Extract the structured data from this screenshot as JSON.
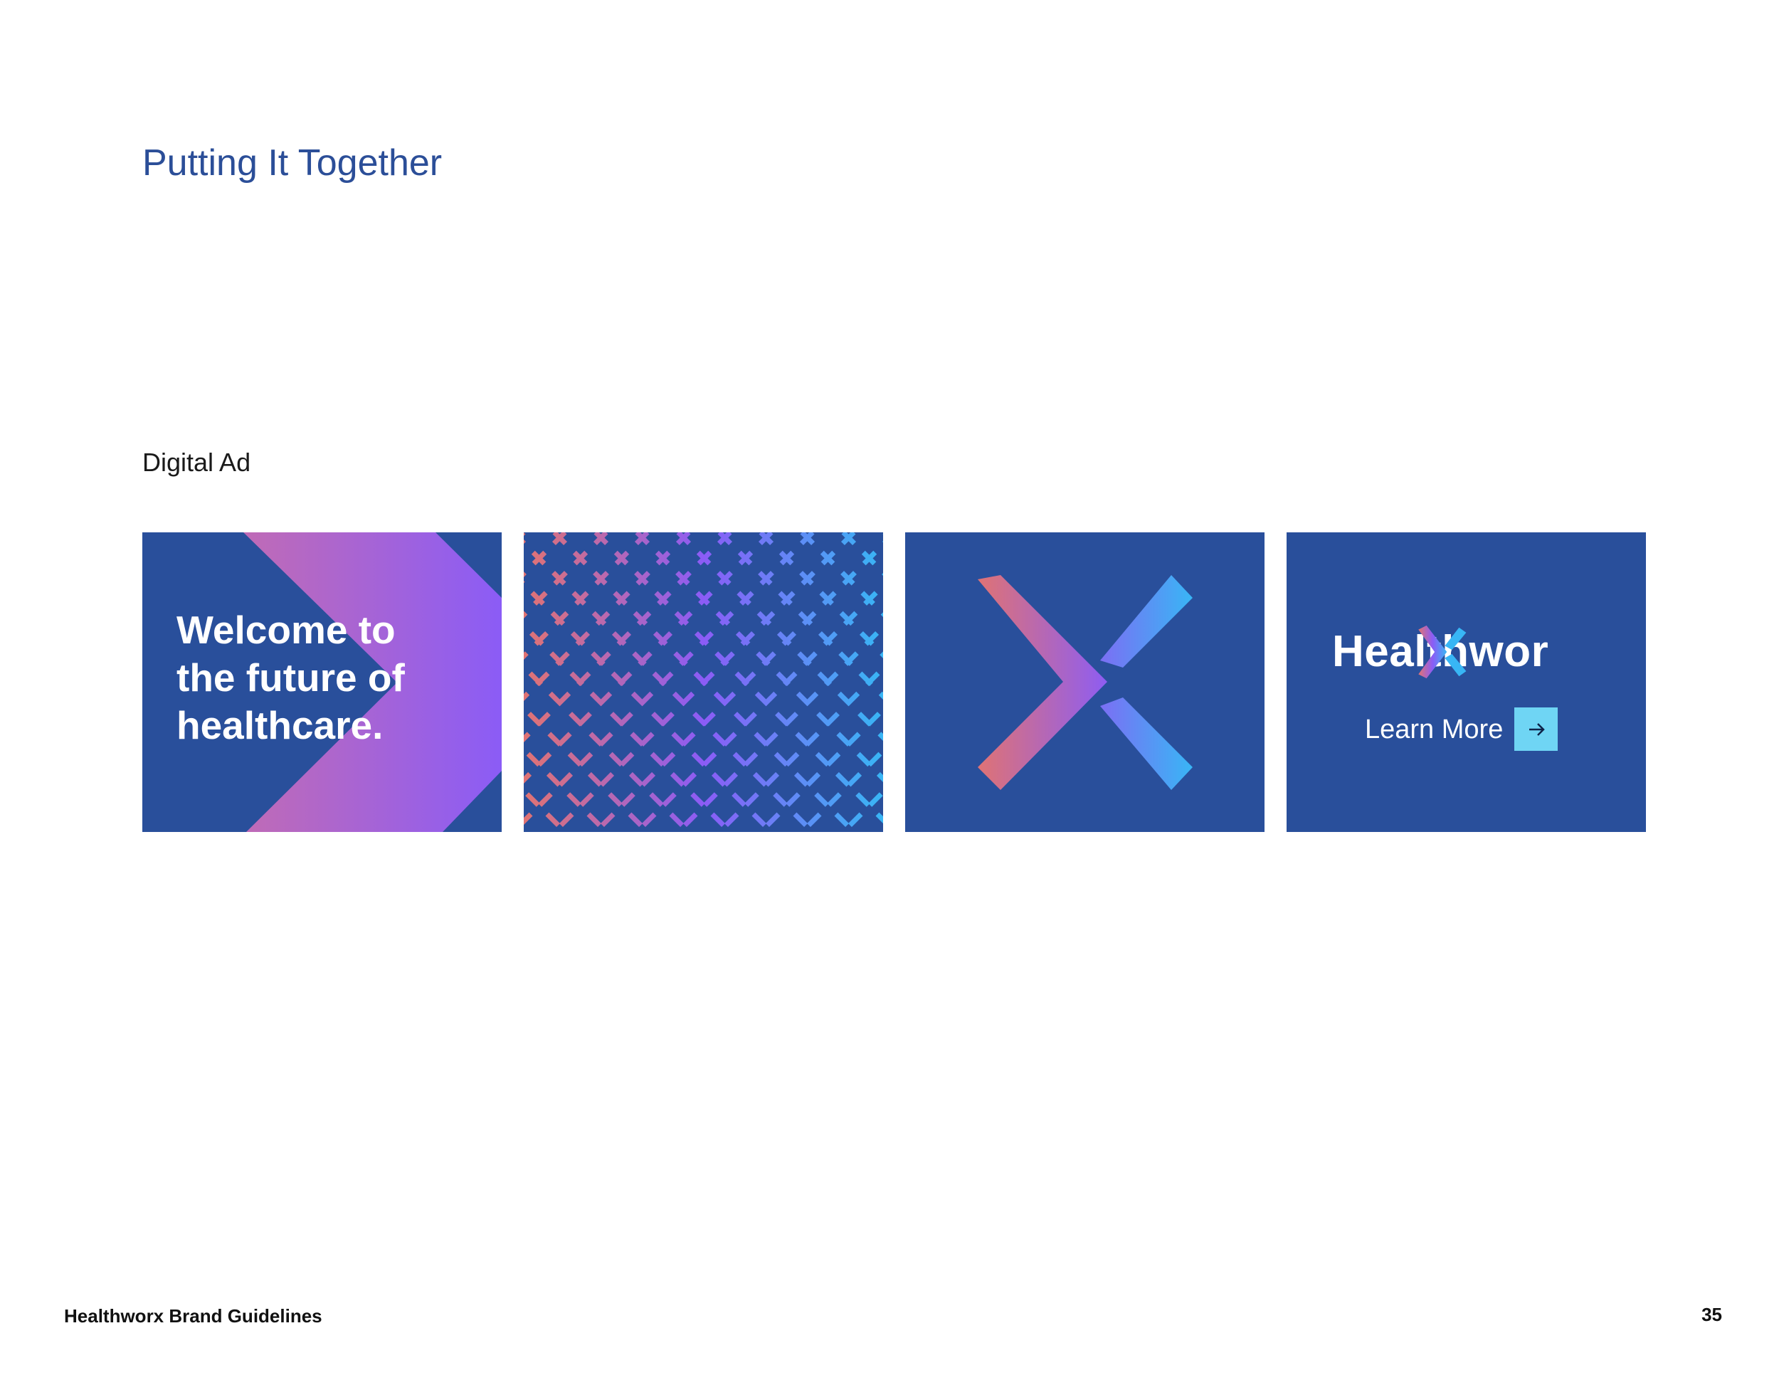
{
  "page": {
    "title": "Putting It Together",
    "section_label": "Digital Ad"
  },
  "ads": {
    "panel1": {
      "headline": [
        "Welcome to",
        "the future of",
        "healthcare."
      ]
    },
    "panel2": {
      "pattern_icon": "x-lattice-pattern-icon"
    },
    "panel3": {
      "mark_icon": "healthworx-x-mark-icon"
    },
    "panel4": {
      "brand_word": "Healthwor",
      "brand_mark_icon": "x-mark-icon",
      "cta_label": "Learn More",
      "cta_icon": "arrow-right-icon"
    }
  },
  "footer": {
    "brand": "Healthworx Brand Guidelines",
    "page_number": "35"
  },
  "colors": {
    "navy": "#294f9b",
    "title_blue": "#2b4e98",
    "coral": "#e07373",
    "violet": "#8b5cf6",
    "sky": "#38b6f5",
    "cta_cyan": "#6fd5f4"
  }
}
